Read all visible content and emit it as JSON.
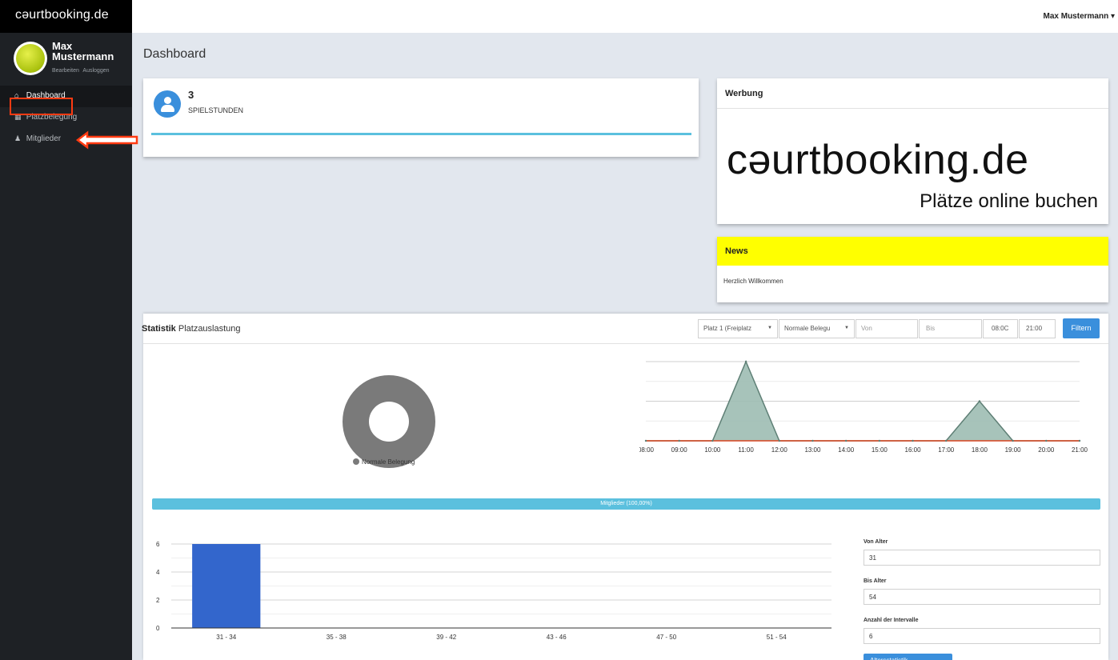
{
  "app": {
    "brand": "cəurtbooking.de",
    "user_menu": "Max Mustermann ▾"
  },
  "sidebar": {
    "profile_name": "Max Mustermann",
    "links": [
      "Bearbeiten",
      "Ausloggen"
    ],
    "items": [
      {
        "label": "Dashboard",
        "icon": "home-icon",
        "glyph": "⌂"
      },
      {
        "label": "Platzbelegung",
        "icon": "calendar-icon",
        "glyph": "▦"
      },
      {
        "label": "Mitglieder",
        "icon": "user-icon",
        "glyph": "♟"
      }
    ]
  },
  "page": {
    "title": "Dashboard"
  },
  "stat_card": {
    "value": "3",
    "label": "SPIELSTUNDEN"
  },
  "werbung": {
    "title": "Werbung",
    "logo_text": "cəurtbooking.de",
    "logo_sub": "Plätze online buchen"
  },
  "news": {
    "title": "News",
    "body": "Herzlich Willkommen"
  },
  "statistik": {
    "title_bold": "Statistik",
    "title_rest": "Platzauslastung",
    "filters": {
      "court": "Platz 1 (Freiplatz",
      "type": "Normale Belegu",
      "from_placeholder": "Von",
      "to_placeholder": "Bis",
      "time_from": "08:0C",
      "time_to": "21:00",
      "button": "Filtern"
    },
    "members_bar": "Mitglieder (100,00%)",
    "age_form": {
      "from_label": "Von Alter",
      "from_value": "31",
      "to_label": "Bis Alter",
      "to_value": "54",
      "intervals_label": "Anzahl der Intervalle",
      "intervals_value": "6",
      "button": "Altersstatistik"
    }
  },
  "colors": {
    "accent": "#3a8fdc",
    "info": "#5bc0de",
    "news": "#ffff00",
    "sidebar": "#1e2125",
    "area_fill": "#9dbcb2",
    "area_line": "#5e7f75",
    "baseline": "#d9431e",
    "bar": "#3366cc",
    "donut": "#7a7a7a"
  },
  "chart_data": [
    {
      "type": "pie",
      "categories": [
        "Normale Belegung"
      ],
      "values": [
        100
      ],
      "donut": true
    },
    {
      "type": "area",
      "x": [
        "08:00",
        "09:00",
        "10:00",
        "11:00",
        "12:00",
        "13:00",
        "14:00",
        "15:00",
        "16:00",
        "17:00",
        "18:00",
        "19:00",
        "20:00",
        "21:00"
      ],
      "values": [
        0,
        0,
        0,
        2,
        0,
        0,
        0,
        0,
        0,
        0,
        1,
        0,
        0,
        0
      ],
      "yticks": [
        0,
        1,
        2
      ],
      "ylim": [
        0,
        2
      ]
    },
    {
      "type": "bar",
      "categories": [
        "31 - 34",
        "35 - 38",
        "39 - 42",
        "43 - 46",
        "47 - 50",
        "51 - 54"
      ],
      "values": [
        6,
        0,
        0,
        0,
        0,
        0
      ],
      "yticks": [
        0,
        2,
        4,
        6
      ],
      "ylim": [
        0,
        6
      ]
    }
  ]
}
